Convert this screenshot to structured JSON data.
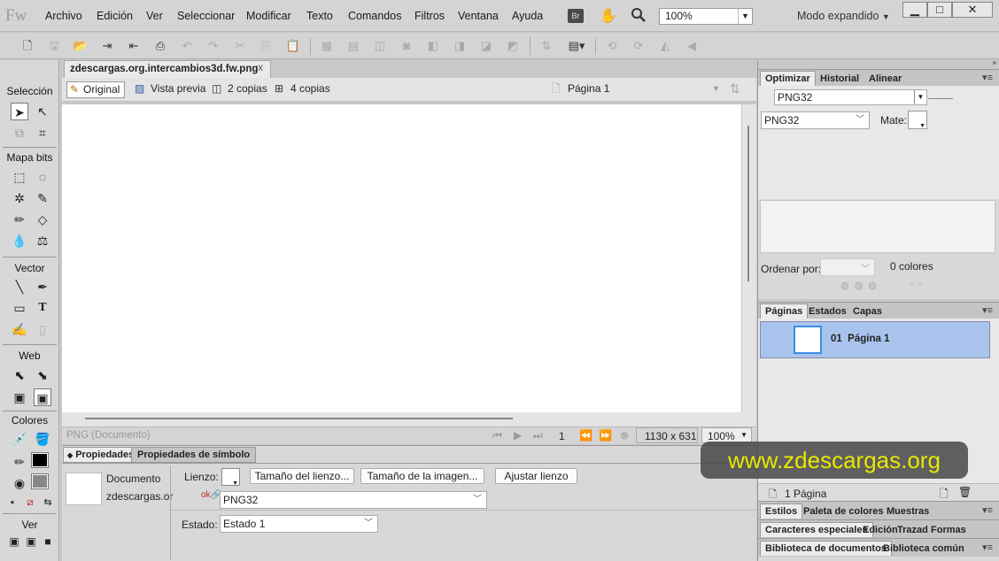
{
  "menubar": {
    "logo": "Fw",
    "items": [
      "Archivo",
      "Edición",
      "Ver",
      "Seleccionar",
      "Modificar",
      "Texto",
      "Comandos",
      "Filtros",
      "Ventana",
      "Ayuda"
    ],
    "br": "Br",
    "zoom": "100%",
    "mode": "Modo expandido"
  },
  "document": {
    "tab_title": "zdescargas.org.intercambios3d.fw.png",
    "close": "x",
    "views": [
      "Original",
      "Vista previa",
      "2 copias",
      "4 copias"
    ],
    "page": "Página 1"
  },
  "tools": {
    "sections": [
      "Selección",
      "Mapa bits",
      "Vector",
      "Web",
      "Colores",
      "Ver"
    ]
  },
  "status": {
    "type": "PNG (Documento)",
    "frame": "1",
    "size": "1130 x 631",
    "zoom": "100%"
  },
  "properties": {
    "tabs": [
      "Propiedades",
      "Propiedades de símbolo"
    ],
    "doc_label": "Documento",
    "doc_name": "zdescargas.or",
    "canvas_label": "Lienzo:",
    "btn_canvas_size": "Tamaño del lienzo...",
    "btn_image_size": "Tamaño de la imagen...",
    "btn_fit": "Ajustar lienzo",
    "format": "PNG32",
    "state_label": "Estado:",
    "state_value": "Estado 1"
  },
  "right": {
    "opt_tabs": [
      "Optimizar",
      "Historial",
      "Alinear"
    ],
    "format1": "PNG32",
    "format2": "PNG32",
    "matte_label": "Mate:",
    "sort_label": "Ordenar por:",
    "colors_count": "0 colores",
    "pages_tabs": [
      "Páginas",
      "Estados",
      "Capas"
    ],
    "page_entry": "01  Página 1",
    "page_count": "1 Página",
    "styles_tabs": [
      "Estilos",
      "Paleta de colores",
      "Muestras"
    ],
    "chars_tabs": [
      "Caracteres especiales",
      "Edición",
      "Trazad",
      "Formas"
    ],
    "lib_tabs": [
      "Biblioteca de documentos",
      "Biblioteca común"
    ]
  },
  "watermark": "www.zdescargas.org"
}
